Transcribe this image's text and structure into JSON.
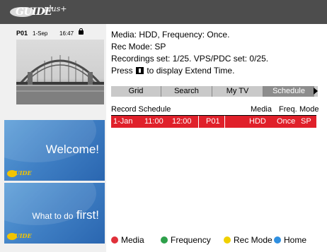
{
  "header": {
    "logo_text": "GUIDE",
    "logo_plus": "plus+"
  },
  "preview": {
    "channel": "P01",
    "date": "1-Sep",
    "time": "16:47",
    "lock_icon": "lock-icon"
  },
  "info": {
    "line1": "Media: HDD, Frequency: Once.",
    "line2": "Rec Mode: SP",
    "line3": "Recordings set: 1/25. VPS/PDC set: 0/25.",
    "line4_before": "Press ",
    "line4_after": " to display Extend Time."
  },
  "tabs": [
    {
      "label": "Grid"
    },
    {
      "label": "Search"
    },
    {
      "label": "My TV"
    },
    {
      "label": "Schedule"
    }
  ],
  "schedule": {
    "title": "Record Schedule",
    "columns": [
      "Media",
      "Freq.",
      "Mode"
    ],
    "rows": [
      {
        "date": "1-Jan",
        "start": "11:00",
        "end": "12:00",
        "channel": "P01",
        "media": "HDD",
        "freq": "Once",
        "mode": "SP"
      }
    ]
  },
  "cards": [
    {
      "message_small": "",
      "message_large": "Welcome!"
    },
    {
      "message_small": "What to do",
      "message_large": "first!"
    }
  ],
  "legend": [
    {
      "label": "Media",
      "color": "#e0303a"
    },
    {
      "label": "Frequency",
      "color": "#2ea04a"
    },
    {
      "label": "Rec Mode",
      "color": "#f0d000"
    },
    {
      "label": "Home",
      "color": "#2f8fe0"
    }
  ],
  "colors": {
    "topbar": "#4d4d4d",
    "highlight_row": "#e0202a",
    "active_tab": "#8d8d8d",
    "card_blue": "#3f7fc4"
  }
}
